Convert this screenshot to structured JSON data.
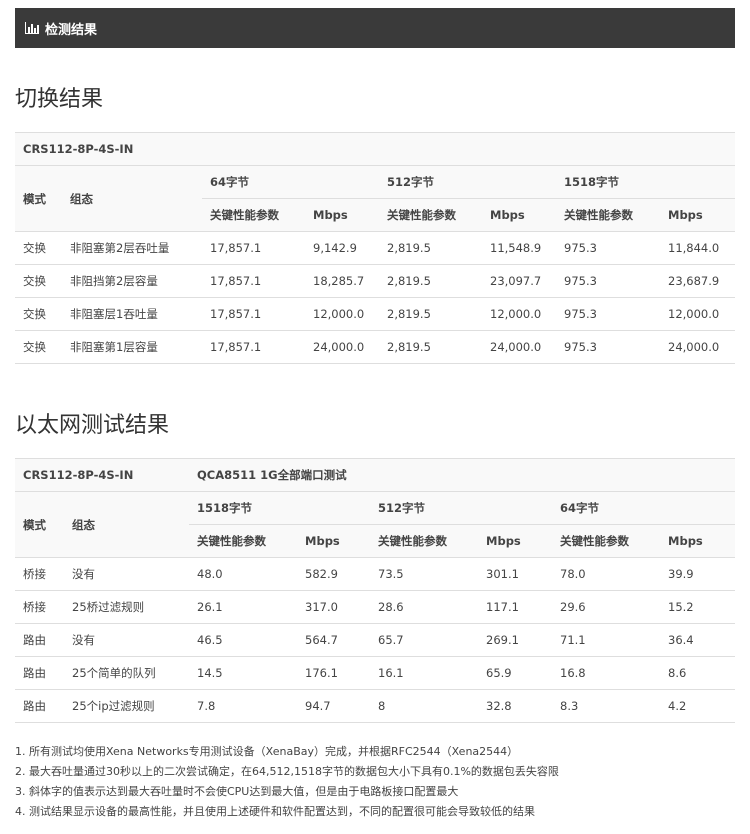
{
  "header": {
    "title": "检测结果",
    "icon": "bar-chart-icon"
  },
  "switching": {
    "title": "切换结果",
    "model": "CRS112-8P-4S-IN",
    "col_mode": "模式",
    "col_config": "组态",
    "groups": [
      "64字节",
      "512字节",
      "1518字节"
    ],
    "sub_kpi": "关键性能参数",
    "sub_mbps": "Mbps",
    "rows": [
      [
        "交换",
        "非阻塞第2层吞吐量",
        "17,857.1",
        "9,142.9",
        "2,819.5",
        "11,548.9",
        "975.3",
        "11,844.0"
      ],
      [
        "交换",
        "非阻挡第2层容量",
        "17,857.1",
        "18,285.7",
        "2,819.5",
        "23,097.7",
        "975.3",
        "23,687.9"
      ],
      [
        "交换",
        "非阻塞层1吞吐量",
        "17,857.1",
        "12,000.0",
        "2,819.5",
        "12,000.0",
        "975.3",
        "12,000.0"
      ],
      [
        "交换",
        "非阻塞第1层容量",
        "17,857.1",
        "24,000.0",
        "2,819.5",
        "24,000.0",
        "975.3",
        "24,000.0"
      ]
    ]
  },
  "ethernet": {
    "title": "以太网测试结果",
    "model": "CRS112-8P-4S-IN",
    "test_name": "QCA8511 1G全部端口测试",
    "col_mode": "模式",
    "col_config": "组态",
    "groups": [
      "1518字节",
      "512字节",
      "64字节"
    ],
    "sub_kpi": "关键性能参数",
    "sub_mbps": "Mbps",
    "rows": [
      [
        "桥接",
        "没有",
        "48.0",
        "582.9",
        "73.5",
        "301.1",
        "78.0",
        "39.9"
      ],
      [
        "桥接",
        "25桥过滤规则",
        "26.1",
        "317.0",
        "28.6",
        "117.1",
        "29.6",
        "15.2"
      ],
      [
        "路由",
        "没有",
        "46.5",
        "564.7",
        "65.7",
        "269.1",
        "71.1",
        "36.4"
      ],
      [
        "路由",
        "25个简单的队列",
        "14.5",
        "176.1",
        "16.1",
        "65.9",
        "16.8",
        "8.6"
      ],
      [
        "路由",
        "25个ip过滤规则",
        "7.8",
        "94.7",
        "8",
        "32.8",
        "8.3",
        "4.2"
      ]
    ]
  },
  "notes": [
    "1. 所有测试均使用Xena Networks专用测试设备（XenaBay）完成，并根据RFC2544（Xena2544）",
    "2. 最大吞吐量通过30秒以上的二次尝试确定，在64,512,1518字节的数据包大小下具有0.1%的数据包丢失容限",
    "3. 斜体字的值表示达到最大吞吐量时不会使CPU达到最大值，但是由于电路板接口配置最大",
    "4. 测试结果显示设备的最高性能，并且使用上述硬件和软件配置达到，不同的配置很可能会导致较低的结果"
  ]
}
